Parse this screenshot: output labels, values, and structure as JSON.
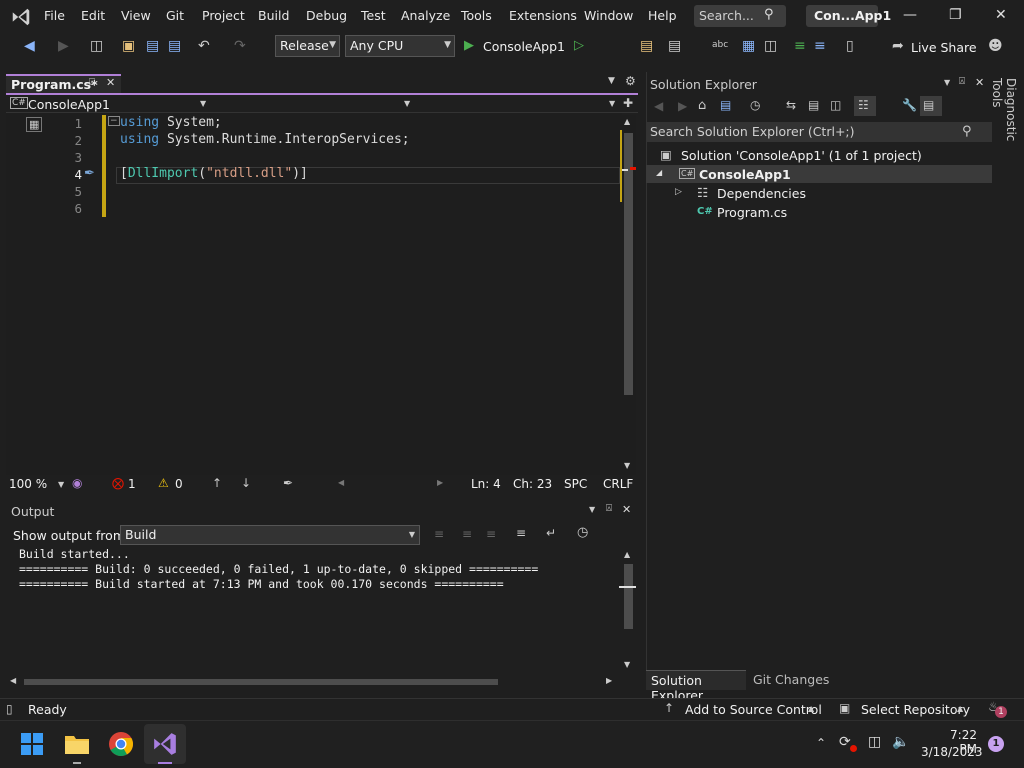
{
  "menu": [
    "File",
    "Edit",
    "View",
    "Git",
    "Project",
    "Build",
    "Debug",
    "Test",
    "Analyze",
    "Tools",
    "Extensions",
    "Window",
    "Help"
  ],
  "search": {
    "placeholder": "Search..."
  },
  "title": "Con...App1",
  "toolbar": {
    "config": "Release",
    "platform": "Any CPU",
    "run_target": "ConsoleApp1",
    "live_share": "Live Share"
  },
  "editor": {
    "tab": "Program.cs*",
    "nav_project": "ConsoleApp1",
    "line_numbers": [
      "1",
      "2",
      "3",
      "4",
      "5",
      "6"
    ],
    "lines": [
      {
        "kw": "using",
        "rest": " System;"
      },
      {
        "kw": "using",
        "rest": " System.Runtime.InteropServices;"
      },
      {
        "kw": "",
        "rest": ""
      },
      {
        "pre": "[",
        "type": "DllImport",
        "open": "(",
        "str": "\"ntdll.dll\"",
        "close": ")]"
      }
    ],
    "zoom": "100 %",
    "errors": "1",
    "warnings": "0",
    "ln": "Ln: 4",
    "ch": "Ch: 23",
    "spc": "SPC",
    "crlf": "CRLF"
  },
  "output": {
    "title": "Output",
    "show_from_label": "Show output from:",
    "source": "Build",
    "lines": [
      "Build started...",
      "========== Build: 0 succeeded, 0 failed, 1 up-to-date, 0 skipped ==========",
      "========== Build started at 7:13 PM and took 00.170 seconds =========="
    ]
  },
  "solution_explorer": {
    "title": "Solution Explorer",
    "search_placeholder": "Search Solution Explorer (Ctrl+;)",
    "solution": "Solution 'ConsoleApp1' (1 of 1 project)",
    "project": "ConsoleApp1",
    "dependencies": "Dependencies",
    "file": "Program.cs",
    "tab_se": "Solution Explorer",
    "tab_git": "Git Changes"
  },
  "rail": {
    "diagnostic": "Diagnostic Tools"
  },
  "statusbar": {
    "ready": "Ready",
    "add_source": "Add to Source Control",
    "select_repo": "Select Repository",
    "notif_count": "1"
  },
  "taskbar": {
    "time": "7:22 PM",
    "date": "3/18/2023",
    "badge": "1"
  }
}
